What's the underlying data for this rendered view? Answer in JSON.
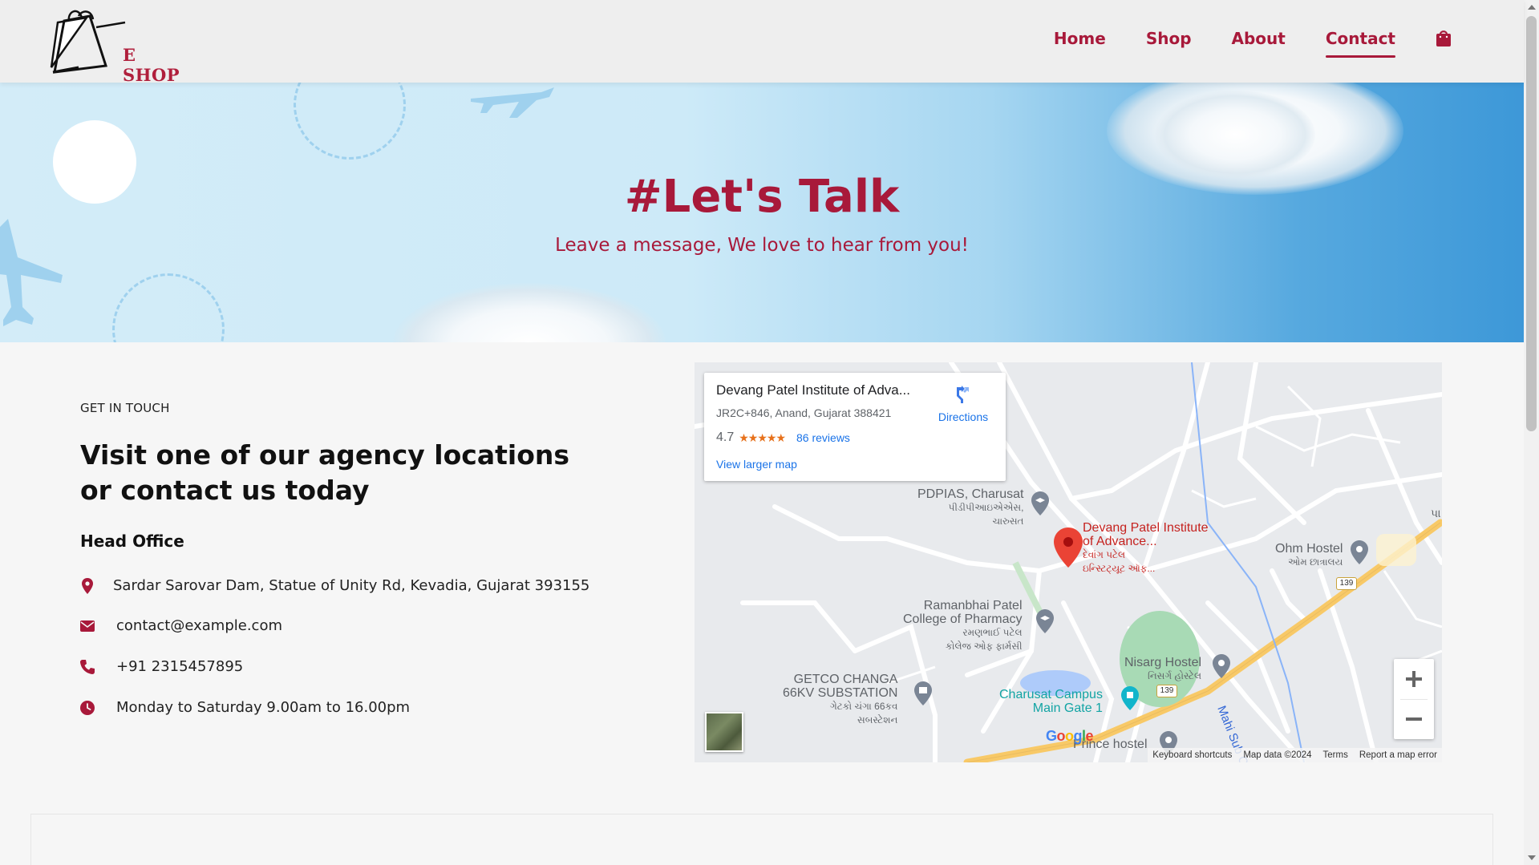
{
  "brand": {
    "logo_text": "E SHOP",
    "accent": "#a8193a"
  },
  "nav": {
    "items": [
      {
        "label": "Home"
      },
      {
        "label": "Shop"
      },
      {
        "label": "About"
      },
      {
        "label": "Contact",
        "active": true
      }
    ],
    "bag_icon": "shopping-bag-icon"
  },
  "hero": {
    "title": "#Let's Talk",
    "subtitle": "Leave a message, We love to hear from you!"
  },
  "contact": {
    "eyebrow": "GET IN TOUCH",
    "heading": "Visit one of our agency locations or contact us today",
    "office_title": "Head Office",
    "items": [
      {
        "icon": "location-pin-icon",
        "text": "Sardar Sarovar Dam, Statue of Unity Rd, Kevadia, Gujarat 393155"
      },
      {
        "icon": "envelope-icon",
        "text": "contact@example.com"
      },
      {
        "icon": "phone-icon",
        "text": "+91 2315457895"
      },
      {
        "icon": "clock-icon",
        "text": "Monday to Saturday 9.00am to 16.00pm"
      }
    ]
  },
  "map": {
    "card": {
      "place": "Devang Patel Institute of Adva...",
      "address": "JR2C+846, Anand, Gujarat 388421",
      "rating": "4.7",
      "stars": "★★★★★",
      "reviews": "86 reviews",
      "larger": "View larger map",
      "directions": "Directions"
    },
    "labels": {
      "pdpias": "PDPIAS, Charusat",
      "pdpias_local": "પીડીપીઆઇએએસ,",
      "pdpias_local2": "ચારુસત",
      "devang": "Devang Patel Institute",
      "devang2": "of Advance...",
      "devang_local": "દેવાંગ પટેલ",
      "devang_local2": "ઇન્સ્ટિટ્યૂટ ઑફ...",
      "ohm": "Ohm Hostel",
      "ohm_local": "ઓમ છાત્રાલય",
      "ramanbhai": "Ramanbhai Patel",
      "ramanbhai2": "College of Pharmacy",
      "ramanbhai_local": "રમણભાઈ પટેલ",
      "ramanbhai_local2": "કોલેજ ઓફ ફાર્મસી",
      "getco": "GETCO CHANGA",
      "getco2": "66KV SUBSTATION",
      "getco_local": "ગેટકો ચંગા 66કવ",
      "getco_local2": "સબસ્ટેશન",
      "nisarg": "Nisarg Hostel",
      "nisarg_local": "નિસર્ગ હોસ્ટેલ",
      "charusat": "Charusat Campus",
      "charusat2": "Main Gate 1",
      "prince": "Prince hostel",
      "mahi": "Mahi Sub C",
      "road": "139",
      "pa": "પા",
      "google": "Google"
    },
    "footer": [
      "Keyboard shortcuts",
      "Map data ©2024",
      "Terms",
      "Report a map error"
    ]
  }
}
